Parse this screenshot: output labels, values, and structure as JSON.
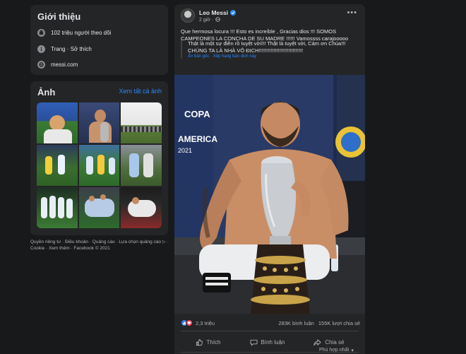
{
  "intro": {
    "title": "Giới thiệu",
    "followers": "102 triệu người theo dõi",
    "category": "Trang · Sở thích",
    "website": "messi.com"
  },
  "photos": {
    "title": "Ảnh",
    "see_all": "Xem tất cả ảnh"
  },
  "footer": {
    "text": "Quyền riêng tư · Điều khoản · Quảng cáo · Lựa chọn quảng cáo ▷ · Cookie · Xem thêm · Facebook © 2021"
  },
  "post": {
    "author": "Leo Messi",
    "time": "2 giờ ·",
    "text": "Que hermosa locura !!! Esto es increíble , Gracias dios !!! SOMOS CAMPEONES LA CONCHA DE SU MADRE !!!!!! Vamossss carajooooo",
    "translation": "Thật là một sự điên rồ tuyệt vời!!! Thật là tuyệt vời, Cảm ơn Chúa!!! CHÚNG TA LÀ NHÀ VÔ ĐỊCH!!!!!!!!!!!!!!!!!!!!!!!!!!!!!!",
    "translation_links": "Ẩn bản gốc · Xếp hạng bản dịch này",
    "photo_banner_1": "COPA",
    "photo_banner_2": "AMERICA",
    "photo_banner_3": "2021",
    "reactions": "2,3 triệu",
    "comments": "283K bình luận",
    "shares": "155K lượt chia sẻ",
    "like": "Thích",
    "comment": "Bình luận",
    "share": "Chia sẻ",
    "sort": "Phù hợp nhất",
    "colors": {
      "accent": "#2d88ff",
      "love": "#f33e58",
      "card": "#242526",
      "bg": "#18191a"
    }
  }
}
